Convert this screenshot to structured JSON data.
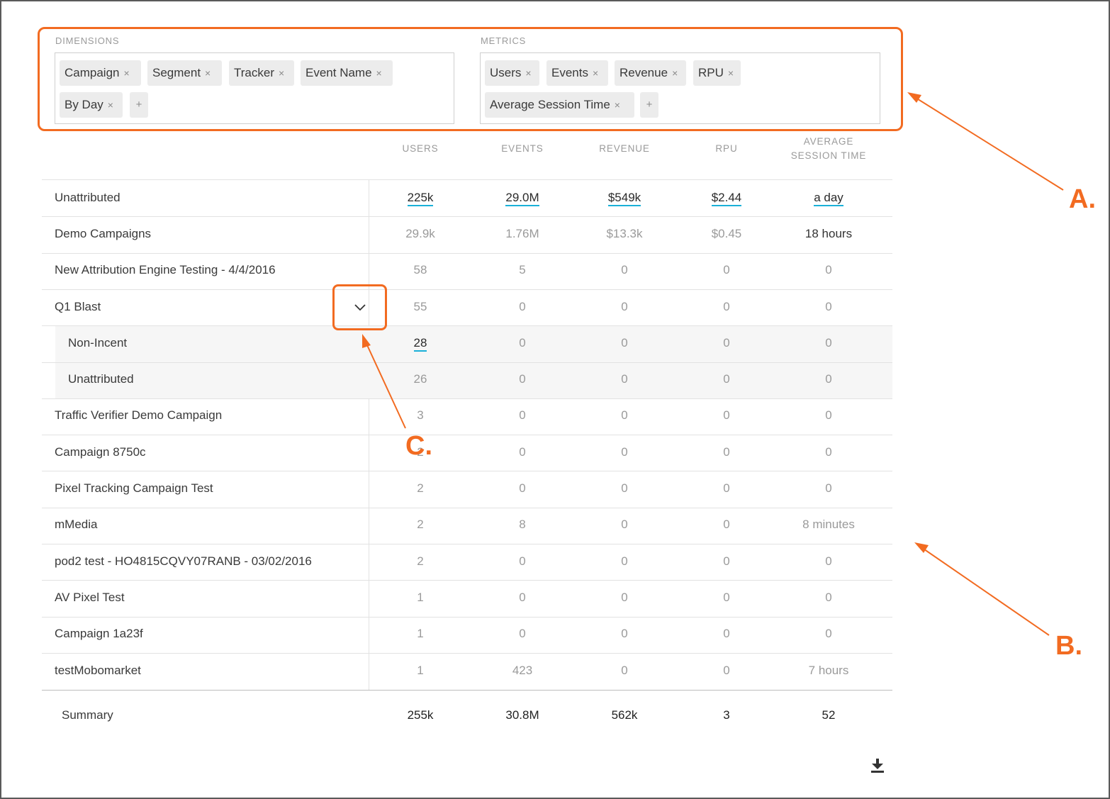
{
  "dimensions": {
    "label": "DIMENSIONS",
    "chips": [
      "Campaign",
      "Segment",
      "Tracker",
      "Event Name",
      "By Day"
    ],
    "add_label": "+"
  },
  "metrics": {
    "label": "METRICS",
    "chips": [
      "Users",
      "Events",
      "Revenue",
      "RPU",
      "Average Session Time"
    ],
    "add_label": "+"
  },
  "chip_remove_glyph": "×",
  "columns": [
    "USERS",
    "EVENTS",
    "REVENUE",
    "RPU",
    "AVERAGE SESSION TIME"
  ],
  "rows": [
    {
      "name": "Unattributed",
      "values": [
        "225k",
        "29.0M",
        "$549k",
        "$2.44",
        "a day"
      ]
    },
    {
      "name": "Demo Campaigns",
      "values": [
        "29.9k",
        "1.76M",
        "$13.3k",
        "$0.45",
        "18 hours"
      ]
    },
    {
      "name": "New Attribution Engine Testing - 4/4/2016",
      "values": [
        "58",
        "5",
        "0",
        "0",
        "0"
      ]
    },
    {
      "name": "Q1 Blast",
      "values": [
        "55",
        "0",
        "0",
        "0",
        "0"
      ]
    },
    {
      "name": "Non-Incent",
      "values": [
        "28",
        "0",
        "0",
        "0",
        "0"
      ]
    },
    {
      "name": "Unattributed",
      "values": [
        "26",
        "0",
        "0",
        "0",
        "0"
      ]
    },
    {
      "name": "Traffic Verifier Demo Campaign",
      "values": [
        "3",
        "0",
        "0",
        "0",
        "0"
      ]
    },
    {
      "name": "Campaign 8750c",
      "values": [
        "2",
        "0",
        "0",
        "0",
        "0"
      ]
    },
    {
      "name": "Pixel Tracking Campaign Test",
      "values": [
        "2",
        "0",
        "0",
        "0",
        "0"
      ]
    },
    {
      "name": "mMedia",
      "values": [
        "2",
        "8",
        "0",
        "0",
        "8 minutes"
      ]
    },
    {
      "name": "pod2 test - HO4815CQVY07RANB - 03/02/2016",
      "values": [
        "2",
        "0",
        "0",
        "0",
        "0"
      ]
    },
    {
      "name": "AV Pixel Test",
      "values": [
        "1",
        "0",
        "0",
        "0",
        "0"
      ]
    },
    {
      "name": "Campaign 1a23f",
      "values": [
        "1",
        "0",
        "0",
        "0",
        "0"
      ]
    },
    {
      "name": "testMobomarket",
      "values": [
        "1",
        "423",
        "0",
        "0",
        "7 hours"
      ]
    }
  ],
  "summary": {
    "label": "Summary",
    "values": [
      "255k",
      "30.8M",
      "562k",
      "3",
      "52"
    ]
  },
  "callouts": {
    "a": "A.",
    "b": "B.",
    "c": "C."
  },
  "accent_color": "#f26b21",
  "link_underline_color": "#1ab0d8",
  "icons": {
    "expand": "chevron-down-icon",
    "download": "download-icon",
    "remove": "close-icon",
    "add": "plus-icon"
  }
}
